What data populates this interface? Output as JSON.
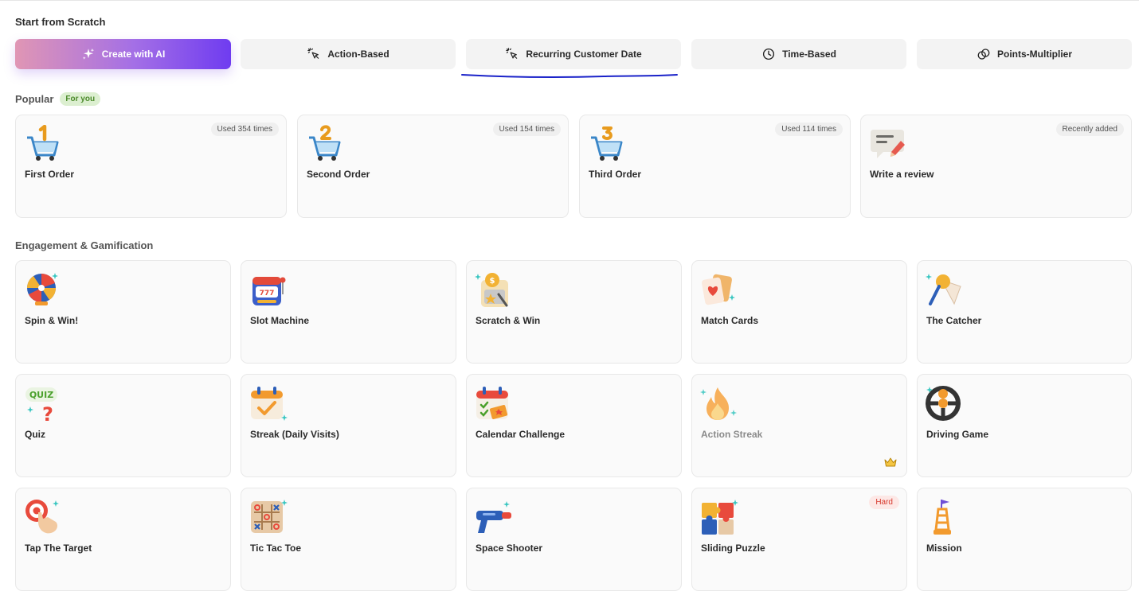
{
  "header": {
    "start_title": "Start from Scratch"
  },
  "scratch": [
    {
      "label": "Create with AI",
      "icon": "sparkles-icon"
    },
    {
      "label": "Action-Based",
      "icon": "cursor-click-icon"
    },
    {
      "label": "Recurring Customer Date",
      "icon": "cursor-click-icon"
    },
    {
      "label": "Time-Based",
      "icon": "clock-icon"
    },
    {
      "label": "Points-Multiplier",
      "icon": "circles-overlap-icon"
    }
  ],
  "popular": {
    "label": "Popular",
    "pill": "For you",
    "cards": [
      {
        "title": "First Order",
        "badge": "Used 354 times",
        "icon": "cart-1-icon"
      },
      {
        "title": "Second Order",
        "badge": "Used 154 times",
        "icon": "cart-2-icon"
      },
      {
        "title": "Third Order",
        "badge": "Used 114 times",
        "icon": "cart-3-icon"
      },
      {
        "title": "Write a review",
        "badge": "Recently added",
        "icon": "review-pencil-icon"
      }
    ]
  },
  "engagement": {
    "label": "Engagement & Gamification",
    "cards": [
      {
        "title": "Spin & Win!",
        "icon": "spin-wheel-icon"
      },
      {
        "title": "Slot Machine",
        "icon": "slot-machine-icon"
      },
      {
        "title": "Scratch & Win",
        "icon": "scratch-card-icon"
      },
      {
        "title": "Match Cards",
        "icon": "playing-cards-icon"
      },
      {
        "title": "The Catcher",
        "icon": "net-catcher-icon"
      },
      {
        "title": "Quiz",
        "icon": "quiz-icon",
        "quiz_text": "QUIZ"
      },
      {
        "title": "Streak (Daily Visits)",
        "icon": "calendar-check-icon"
      },
      {
        "title": "Calendar Challenge",
        "icon": "calendar-ticket-icon"
      },
      {
        "title": "Action Streak",
        "icon": "flame-icon",
        "premium": "crown-icon"
      },
      {
        "title": "Driving Game",
        "icon": "steering-wheel-icon"
      },
      {
        "title": "Tap The Target",
        "icon": "tap-target-icon"
      },
      {
        "title": "Tic Tac Toe",
        "icon": "tic-tac-toe-icon"
      },
      {
        "title": "Space Shooter",
        "icon": "blaster-icon"
      },
      {
        "title": "Sliding Puzzle",
        "icon": "puzzle-icon",
        "badge": "Hard"
      },
      {
        "title": "Mission",
        "icon": "flag-tower-icon"
      }
    ]
  },
  "colors": {
    "accent_start": "#e096b4",
    "accent_end": "#6f3cf0",
    "pen_underline": "#1a22c9",
    "hard": "#d7382c",
    "for_you": "#4b8a2a"
  }
}
